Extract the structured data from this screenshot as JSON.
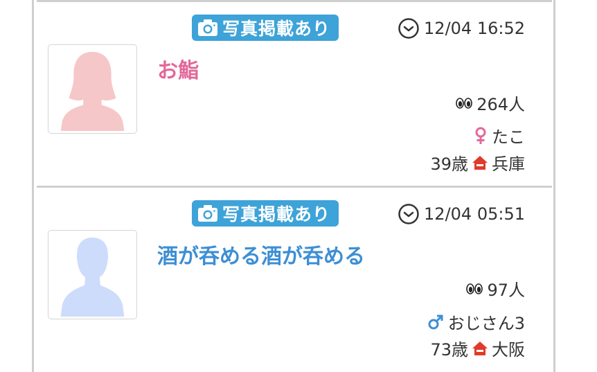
{
  "posts": [
    {
      "badge_label": "写真掲載あり",
      "time": "12/04 16:52",
      "title": "お鮨",
      "title_color": "#e2689a",
      "views": "264人",
      "gender": "female",
      "gender_color": "#e2689a",
      "username": "たこ",
      "age": "39歳",
      "area": "兵庫",
      "avatar_color": "#f6c7c8"
    },
    {
      "badge_label": "写真掲載あり",
      "time": "12/04 05:51",
      "title": "酒が呑める酒が呑める",
      "title_color": "#3d8fd4",
      "views": "97人",
      "gender": "male",
      "gender_color": "#3d8fd4",
      "username": "おじさん3",
      "age": "73歳",
      "area": "大阪",
      "avatar_color": "#cddcfb"
    }
  ],
  "colors": {
    "badge": "#3ea3d8",
    "home_icon": "#e23a2a",
    "separator": "#cfcfcf"
  }
}
